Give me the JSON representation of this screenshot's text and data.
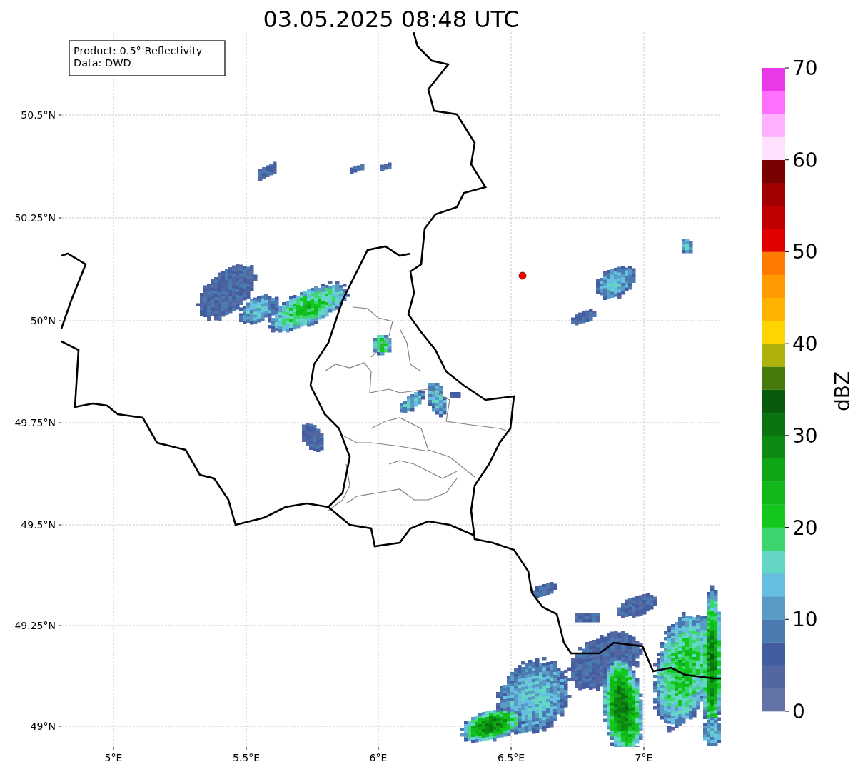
{
  "title": "03.05.2025 08:48 UTC",
  "info_box": [
    "Product: 0.5° Reflectivity",
    "Data: DWD"
  ],
  "x_ticks": [
    "5°E",
    "5.5°E",
    "6°E",
    "6.5°E",
    "7°E"
  ],
  "y_ticks": [
    "50.5°N",
    "50.25°N",
    "50°N",
    "49.75°N",
    "49.5°N",
    "49.25°N",
    "49°N"
  ],
  "colorbar": {
    "label": "dBZ",
    "ticks": [
      "70",
      "60",
      "50",
      "40",
      "30",
      "20",
      "10",
      "0"
    ],
    "segments": [
      {
        "color": "#6473a5"
      },
      {
        "color": "#5366a0"
      },
      {
        "color": "#435ea0"
      },
      {
        "color": "#4a7ab0"
      },
      {
        "color": "#5a9bc6"
      },
      {
        "color": "#66bfe0"
      },
      {
        "color": "#63d6c4"
      },
      {
        "color": "#3dd66e"
      },
      {
        "color": "#13c81c"
      },
      {
        "color": "#10b81a"
      },
      {
        "color": "#0fa615"
      },
      {
        "color": "#0d8a12"
      },
      {
        "color": "#0b7310"
      },
      {
        "color": "#085a0c"
      },
      {
        "color": "#467a0d"
      },
      {
        "color": "#aeb20a"
      },
      {
        "color": "#fed500"
      },
      {
        "color": "#ffb300"
      },
      {
        "color": "#ff9a00"
      },
      {
        "color": "#ff7a00"
      },
      {
        "color": "#e00000"
      },
      {
        "color": "#c00000"
      },
      {
        "color": "#a00000"
      },
      {
        "color": "#780000"
      },
      {
        "color": "#ffe0ff"
      },
      {
        "color": "#ffb0ff"
      },
      {
        "color": "#ff70ff"
      },
      {
        "color": "#e838e8"
      }
    ]
  }
}
